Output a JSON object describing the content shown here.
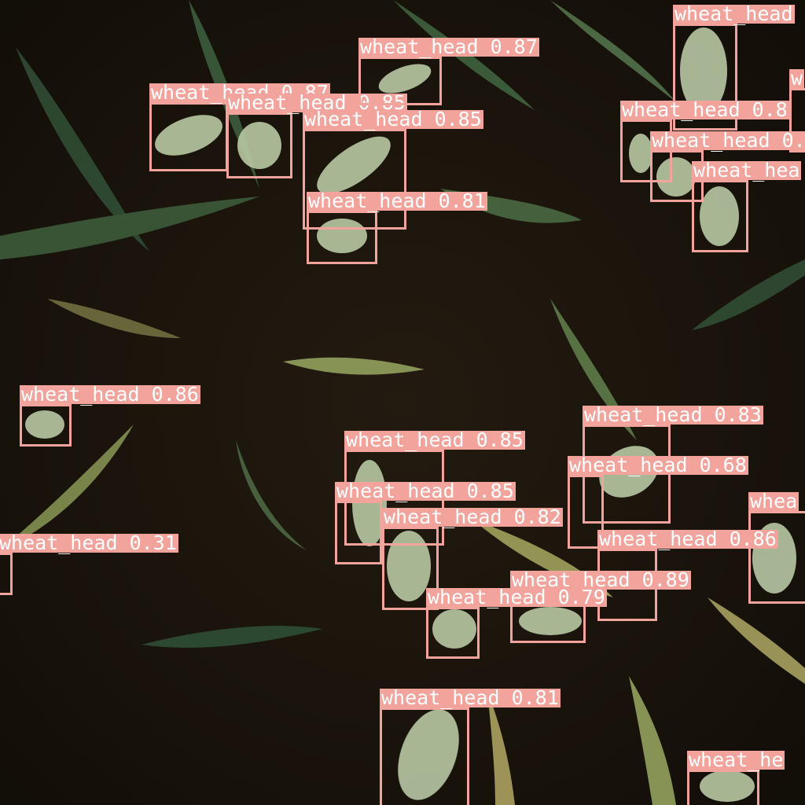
{
  "image": {
    "description_colors": {
      "soil": "#1b150d",
      "leaf_dark": "#2f4a32",
      "leaf_light": "#8d9a5a",
      "leaf_dry": "#a49a5c",
      "wheat": "#b9c9a4",
      "box": "#f2a39c",
      "label_text": "#ffffff"
    }
  },
  "detections": [
    {
      "label": "wheat_head",
      "score": "0.87",
      "text": "wheat_head 0.87"
    },
    {
      "label": "wheat_head",
      "score": "0.85",
      "text": "wheat_head 0.85"
    },
    {
      "label": "wheat_head",
      "score": "0.87",
      "text": "wheat_head 0.87"
    },
    {
      "label": "wheat_head",
      "score": "0.85",
      "text": "wheat_head 0.85"
    },
    {
      "label": "wheat_head",
      "score": "0.81",
      "text": "wheat_head 0.81"
    },
    {
      "label": "wheat_head",
      "score": "",
      "text": "wheat_head"
    },
    {
      "label": "wheat_head",
      "score": "",
      "text": "w"
    },
    {
      "label": "wheat_head",
      "score": "",
      "text": "wheat_head 0.8"
    },
    {
      "label": "wheat_head",
      "score": "",
      "text": "wheat_head 0."
    },
    {
      "label": "wheat_head",
      "score": "",
      "text": "wheat_hea"
    },
    {
      "label": "wheat_head",
      "score": "0.86",
      "text": "wheat_head 0.86"
    },
    {
      "label": "wheat_head",
      "score": "0.31",
      "text": "wheat_head 0.31"
    },
    {
      "label": "wheat_head",
      "score": "0.83",
      "text": "wheat_head 0.83"
    },
    {
      "label": "wheat_head",
      "score": "0.68",
      "text": "wheat_head 0.68"
    },
    {
      "label": "wheat_head",
      "score": "0.85",
      "text": "wheat_head 0.85"
    },
    {
      "label": "wheat_head",
      "score": "0.85",
      "text": "wheat_head 0.85"
    },
    {
      "label": "wheat_head",
      "score": "0.82",
      "text": "wheat_head 0.82"
    },
    {
      "label": "wheat_head",
      "score": "0.86",
      "text": "wheat_head 0.86"
    },
    {
      "label": "wheat_head",
      "score": "",
      "text": "whea"
    },
    {
      "label": "wheat_head",
      "score": "0.89",
      "text": "wheat_head 0.89"
    },
    {
      "label": "wheat_head",
      "score": "0.79",
      "text": "wheat_head 0.79"
    },
    {
      "label": "wheat_head",
      "score": "0.81",
      "text": "wheat_head 0.81"
    },
    {
      "label": "wheat_head",
      "score": "",
      "text": "wheat_he"
    }
  ]
}
